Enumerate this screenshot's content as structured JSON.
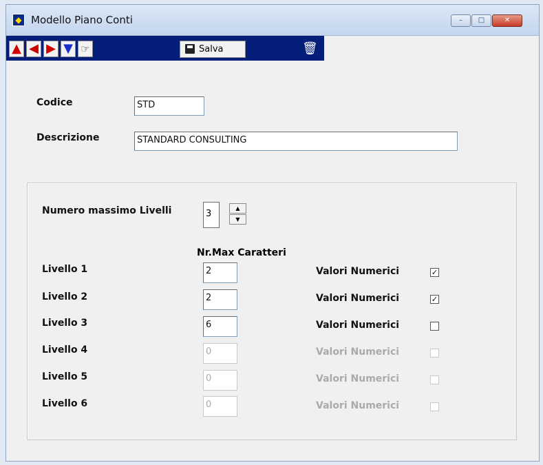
{
  "window": {
    "title": "Modello Piano Conti",
    "controls": {
      "minimize": "–",
      "maximize": "□",
      "close": "✕"
    }
  },
  "toolbar": {
    "nav_icons": [
      "first-arrow-icon",
      "prev-arrow-icon",
      "next-arrow-icon",
      "last-arrow-icon",
      "find-icon"
    ],
    "save_label": "Salva",
    "delete_icon": "trash-icon"
  },
  "form": {
    "codice_label": "Codice",
    "codice_value": "STD",
    "descrizione_label": "Descrizione",
    "descrizione_value": "STANDARD CONSULTING",
    "num_livelli_label": "Numero massimo Livelli",
    "num_livelli_value": "3",
    "column_header": "Nr.Max Caratteri",
    "levels": [
      {
        "label": "Livello 1",
        "value": "2",
        "numeric_label": "Valori Numerici",
        "checked": true,
        "enabled": true
      },
      {
        "label": "Livello 2",
        "value": "2",
        "numeric_label": "Valori Numerici",
        "checked": true,
        "enabled": true
      },
      {
        "label": "Livello 3",
        "value": "6",
        "numeric_label": "Valori Numerici",
        "checked": false,
        "enabled": true
      },
      {
        "label": "Livello 4",
        "value": "0",
        "numeric_label": "Valori Numerici",
        "checked": false,
        "enabled": false
      },
      {
        "label": "Livello 5",
        "value": "0",
        "numeric_label": "Valori Numerici",
        "checked": false,
        "enabled": false
      },
      {
        "label": "Livello 6",
        "value": "0",
        "numeric_label": "Valori Numerici",
        "checked": false,
        "enabled": false
      }
    ]
  },
  "colors": {
    "toolbar_bg": "#041e7a",
    "window_bg": "#f0f0f0",
    "disabled_text": "#aaaaaa"
  }
}
